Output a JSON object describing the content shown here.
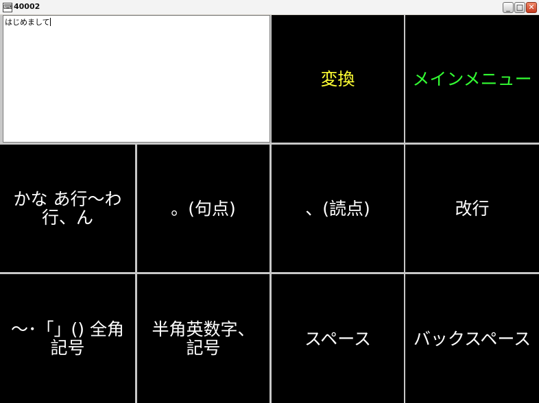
{
  "window": {
    "title": "40002",
    "minimize_glyph": "_",
    "maximize_glyph": "□",
    "close_glyph": "✕"
  },
  "editor": {
    "text": "はじめまして"
  },
  "colors": {
    "key_bg": "#000000",
    "key_text": "#ffffff",
    "convert_text": "#ffff33",
    "menu_text": "#33ff33"
  },
  "keys": {
    "convert": "変換",
    "main_menu": "メインメニュー",
    "kana_line1": "かな あ行～わ",
    "kana_line2": "行、ん",
    "period": "。(句点)",
    "comma": "、(読点)",
    "newline": "改行",
    "symbols_line1": "～･「」() 全角",
    "symbols_line2": "記号",
    "halfwidth_line1": "半角英数字、",
    "halfwidth_line2": "記号",
    "space": "スペース",
    "backspace": "バックスペース"
  }
}
